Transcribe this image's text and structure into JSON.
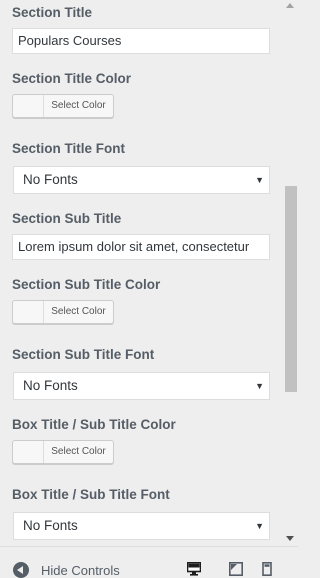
{
  "fields": {
    "section_title_label": "Section Title",
    "section_title_value": "Populars Courses",
    "section_title_color_label": "Section Title Color",
    "section_title_color_button": "Select Color",
    "section_title_font_label": "Section Title Font",
    "section_title_font_value": "No Fonts",
    "section_sub_title_label": "Section Sub Title",
    "section_sub_title_value": "Lorem ipsum dolor sit amet, consectetur",
    "section_sub_title_color_label": "Section Sub Title Color",
    "section_sub_title_color_button": "Select Color",
    "section_sub_title_font_label": "Section Sub Title Font",
    "section_sub_title_font_value": "No Fonts",
    "box_title_color_label": "Box Title / Sub Title Color",
    "box_title_color_button": "Select Color",
    "box_title_font_label": "Box Title / Sub Title Font",
    "box_title_font_value": "No Fonts"
  },
  "footer": {
    "hide_controls_label": "Hide Controls",
    "devices": [
      "desktop-icon",
      "tablet-icon",
      "mobile-icon"
    ]
  },
  "colors": {
    "panel_bg": "#eeeeee",
    "label": "#555d66",
    "input_border": "#dddddd",
    "scroll_thumb": "#c1c1c1"
  }
}
